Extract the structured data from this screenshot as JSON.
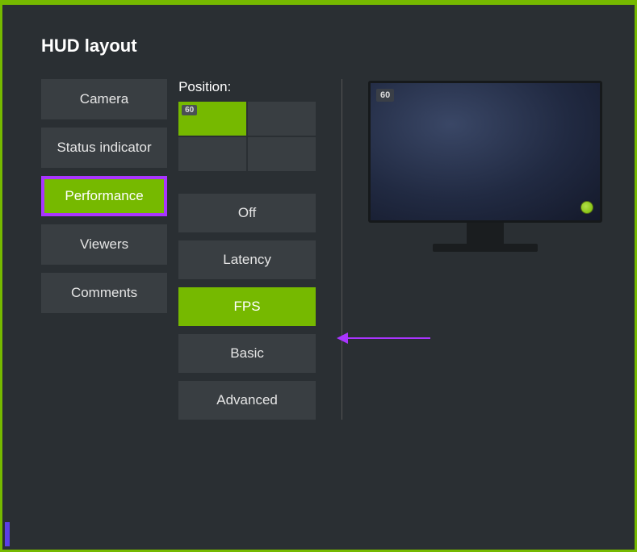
{
  "title": "HUD layout",
  "sidebar": {
    "items": [
      {
        "label": "Camera",
        "key": "camera",
        "active": false
      },
      {
        "label": "Status indicator",
        "key": "status-indicator",
        "active": false
      },
      {
        "label": "Performance",
        "key": "performance",
        "active": true
      },
      {
        "label": "Viewers",
        "key": "viewers",
        "active": false
      },
      {
        "label": "Comments",
        "key": "comments",
        "active": false
      }
    ]
  },
  "position": {
    "label": "Position:",
    "badge": "60",
    "cells": [
      {
        "pos": "top-left",
        "active": true
      },
      {
        "pos": "top-right",
        "active": false
      },
      {
        "pos": "bottom-left",
        "active": false
      },
      {
        "pos": "bottom-right",
        "active": false
      }
    ]
  },
  "options": [
    {
      "label": "Off",
      "key": "off",
      "active": false
    },
    {
      "label": "Latency",
      "key": "latency",
      "active": false
    },
    {
      "label": "FPS",
      "key": "fps",
      "active": true
    },
    {
      "label": "Basic",
      "key": "basic",
      "active": false
    },
    {
      "label": "Advanced",
      "key": "advanced",
      "active": false
    }
  ],
  "preview": {
    "fps_badge": "60"
  },
  "colors": {
    "accent": "#76b900",
    "highlight": "#a935ff",
    "panel": "#393e42",
    "bg": "#2a2f33"
  }
}
